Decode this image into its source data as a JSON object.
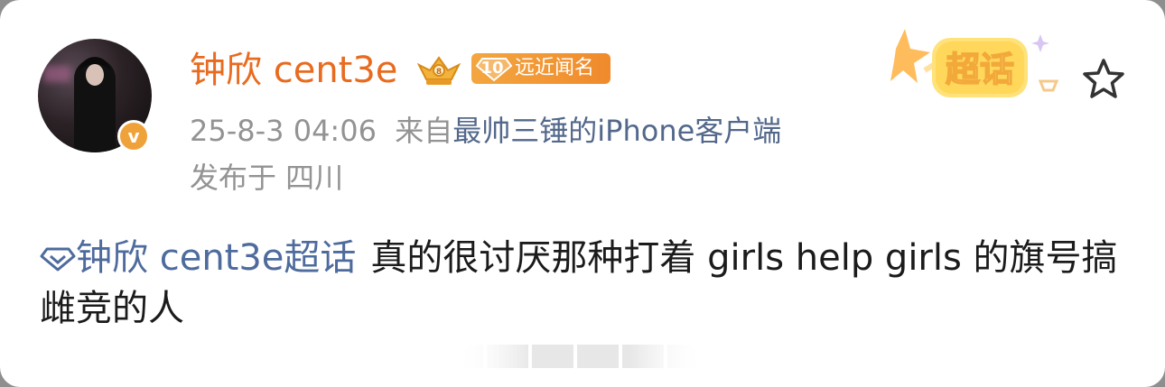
{
  "post": {
    "author_name": "钟欣 cent3e",
    "rank_level": "10",
    "rank_title": "远近闻名",
    "verified_mark": "v",
    "timestamp": "25-8-3 04:06",
    "source_prefix": "来自",
    "source_device": "最帅三锤的iPhone客户端",
    "location": "发布于 四川",
    "topic_name": "钟欣 cent3e超话",
    "body_text": "真的很讨厌那种打着 girls help girls 的旗号搞雌竞的人"
  },
  "supertopic_badge": {
    "label": "超话"
  },
  "colors": {
    "username": "#e86b1f",
    "meta": "#939393",
    "source_link": "#53688b",
    "topic_link": "#4e6b9d",
    "badge_orange": "#f3a640"
  },
  "icons": {
    "crown": "crown-icon",
    "rank": "diamond-rank-icon",
    "supertopic": "supertopic-icon",
    "favorite": "star-icon",
    "topic": "diamond-icon",
    "verified": "verified-icon"
  }
}
